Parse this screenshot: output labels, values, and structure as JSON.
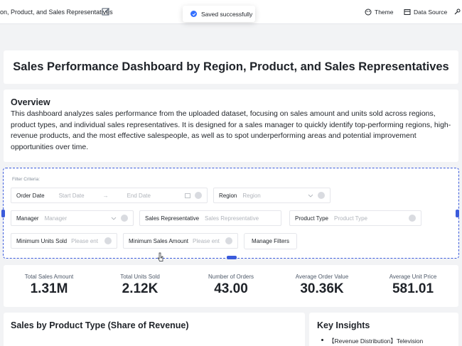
{
  "topbar": {
    "doc_title": "on, Product, and Sales Representatives",
    "theme_label": "Theme",
    "data_source_label": "Data Source"
  },
  "toast": {
    "message": "Saved successfully"
  },
  "title": "Sales Performance Dashboard by Region, Product, and Sales Representatives",
  "overview": {
    "heading": "Overview",
    "text": "This dashboard analyzes sales performance from the uploaded dataset, focusing on sales amount and units sold across regions, product types, and individual sales representatives. It is designed for a sales manager to quickly identify top-performing regions, high-revenue products, and the most effective salespeople, as well as to spot underperforming areas and potential improvement opportunities over time."
  },
  "filters": {
    "criteria_label": "Filter Criteria:",
    "order_date": {
      "label": "Order Date",
      "start_placeholder": "Start Date",
      "end_placeholder": "End Date"
    },
    "region": {
      "label": "Region",
      "placeholder": "Region"
    },
    "manager": {
      "label": "Manager",
      "placeholder": "Manager"
    },
    "sales_rep": {
      "label": "Sales Representative",
      "placeholder": "Sales Representative"
    },
    "product_type": {
      "label": "Product Type",
      "placeholder": "Product Type"
    },
    "min_units": {
      "label": "Minimum Units Sold",
      "placeholder": "Please ent"
    },
    "min_sales": {
      "label": "Minimum Sales Amount",
      "placeholder": "Please ent"
    },
    "manage_label": "Manage Filters"
  },
  "kpis": [
    {
      "label": "Total Sales Amount",
      "value": "1.31M"
    },
    {
      "label": "Total Units Sold",
      "value": "2.12K"
    },
    {
      "label": "Number of Orders",
      "value": "43.00"
    },
    {
      "label": "Average Order Value",
      "value": "30.36K"
    },
    {
      "label": "Average Unit Price",
      "value": "581.01"
    }
  ],
  "chart_section": {
    "title": "Sales by Product Type (Share of Revenue)"
  },
  "insights": {
    "title": "Key Insights",
    "first_item": "【Revenue Distribution】Television"
  },
  "colors": {
    "accent": "#3370ff",
    "selection": "#3b5bdb"
  }
}
